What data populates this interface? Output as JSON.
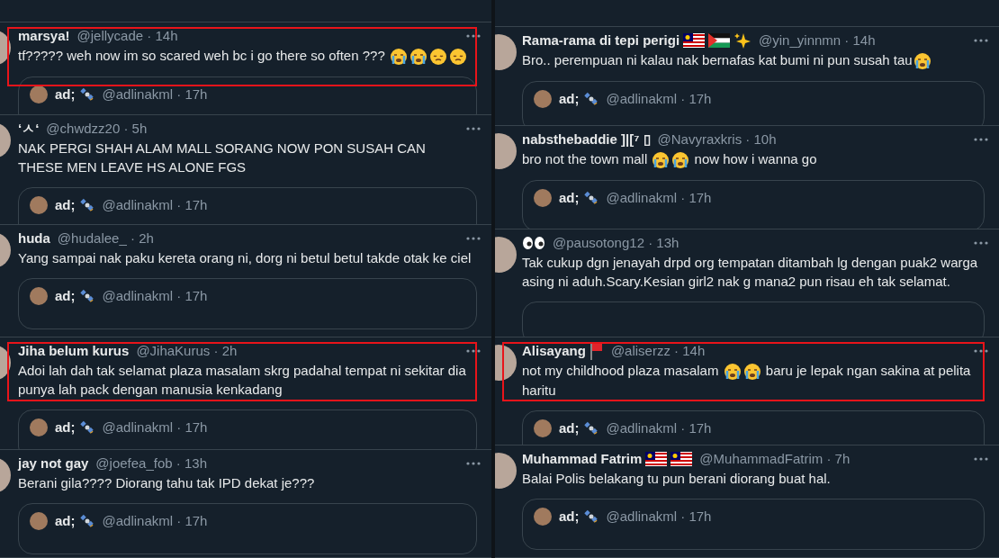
{
  "columns": [
    {
      "tweets": [
        {
          "name": "marsya!",
          "meta": "@jellycade · 14h",
          "highlighted": true,
          "body": [
            {
              "kind": "text",
              "text": "tf????? weh now im so scared weh bc i go there so often ??? "
            },
            {
              "kind": "crying"
            },
            {
              "kind": "crying"
            },
            {
              "kind": "sad"
            },
            {
              "kind": "sad"
            }
          ],
          "quote": {
            "name": "ad;",
            "name_icons": [
              {
                "kind": "satellite"
              }
            ],
            "meta": "@adlinakml · 17h"
          }
        },
        {
          "name": "‘ㅅ‘",
          "meta": "@chwdzz20 · 5h",
          "highlighted": false,
          "body": [
            {
              "kind": "text",
              "text": "NAK PERGI SHAH ALAM MALL SORANG NOW PON SUSAH CAN THESE MEN LEAVE HS ALONE FGS"
            }
          ],
          "quote": {
            "name": "ad;",
            "name_icons": [
              {
                "kind": "satellite"
              }
            ],
            "meta": "@adlinakml · 17h"
          }
        },
        {
          "name": "huda",
          "meta": "@hudalee_ · 2h",
          "highlighted": false,
          "body": [
            {
              "kind": "text",
              "text": "Yang sampai nak paku kereta orang ni, dorg ni betul betul takde otak ke ciel"
            }
          ],
          "quote": {
            "name": "ad;",
            "name_icons": [
              {
                "kind": "satellite"
              }
            ],
            "meta": "@adlinakml · 17h"
          }
        },
        {
          "name": "Jiha belum kurus",
          "meta": "@JihaKurus · 2h",
          "highlighted": true,
          "body": [
            {
              "kind": "text",
              "text": "Adoi lah dah tak selamat plaza masalam skrg padahal tempat ni sekitar dia punya lah pack dengan manusia kenkadang"
            }
          ],
          "quote": {
            "name": "ad;",
            "name_icons": [
              {
                "kind": "satellite"
              }
            ],
            "meta": "@adlinakml · 17h"
          }
        },
        {
          "name": "jay not gay",
          "meta": "@joefea_fob · 13h",
          "highlighted": false,
          "body": [
            {
              "kind": "text",
              "text": "Berani gila???? Diorang tahu tak IPD dekat je???"
            }
          ],
          "quote": {
            "name": "ad;",
            "name_icons": [
              {
                "kind": "satellite"
              }
            ],
            "meta": "@adlinakml · 17h"
          }
        }
      ]
    },
    {
      "tweets": [
        {
          "name": "Rama-rama di tepi perigi",
          "name_icons": [
            {
              "kind": "malaysia"
            },
            {
              "kind": "palestine"
            },
            {
              "kind": "sparkles"
            }
          ],
          "meta": "@yin_yinnmn · 14h",
          "highlighted": false,
          "body": [
            {
              "kind": "text",
              "text": "Bro.. perempuan ni kalau nak bernafas kat bumi ni pun susah tau"
            },
            {
              "kind": "crying"
            }
          ],
          "quote": {
            "name": "ad;",
            "name_icons": [
              {
                "kind": "satellite"
              }
            ],
            "meta": "@adlinakml · 17h"
          }
        },
        {
          "name": "nabsthebaddie ]|[⁷ ▯",
          "meta": "@Navyraxkris · 10h",
          "highlighted": false,
          "body": [
            {
              "kind": "text",
              "text": "bro not the town mall "
            },
            {
              "kind": "crying"
            },
            {
              "kind": "crying"
            },
            {
              "kind": "text",
              "text": " now how i wanna go"
            }
          ],
          "quote": {
            "name": "ad;",
            "name_icons": [
              {
                "kind": "satellite"
              }
            ],
            "meta": "@adlinakml · 17h"
          }
        },
        {
          "name_icons": [
            {
              "kind": "eyes"
            }
          ],
          "meta": "@pausotong12 · 13h",
          "highlighted": false,
          "body": [
            {
              "kind": "text",
              "text": "Tak cukup dgn jenayah drpd org tempatan ditambah lg dengan puak2 warga asing ni aduh.Scary.Kesian girl2 nak g mana2 pun risau eh tak selamat."
            }
          ]
        },
        {
          "name": "Alisayang",
          "name_icons": [
            {
              "kind": "redflag"
            }
          ],
          "meta": "@aliserzz · 14h",
          "highlighted": true,
          "body": [
            {
              "kind": "text",
              "text": "not my childhood plaza masalam "
            },
            {
              "kind": "crying"
            },
            {
              "kind": "crying"
            },
            {
              "kind": "text",
              "text": " baru je lepak ngan sakina at pelita haritu"
            }
          ],
          "quote": {
            "name": "ad;",
            "name_icons": [
              {
                "kind": "satellite"
              }
            ],
            "meta": "@adlinakml · 17h"
          }
        },
        {
          "name": "Muhammad Fatrim",
          "name_icons": [
            {
              "kind": "malaysia"
            },
            {
              "kind": "malaysia"
            }
          ],
          "meta": "@MuhammadFatrim · 7h",
          "highlighted": false,
          "body": [
            {
              "kind": "text",
              "text": "Balai Polis belakang tu pun berani diorang buat hal."
            }
          ],
          "quote": {
            "name": "ad;",
            "name_icons": [
              {
                "kind": "satellite"
              }
            ],
            "meta": "@adlinakml · 17h"
          }
        }
      ]
    }
  ]
}
